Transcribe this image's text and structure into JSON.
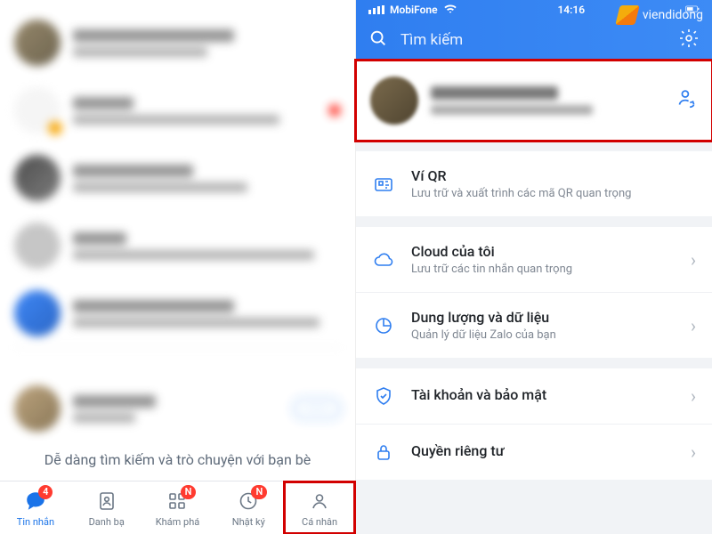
{
  "watermark": {
    "text": "viendidong"
  },
  "left": {
    "hint_text": "Dễ dàng tìm kiếm và trò chuyện với bạn bè",
    "nav": {
      "messages": {
        "label": "Tin nhắn",
        "badge": "4"
      },
      "contacts": {
        "label": "Danh bạ"
      },
      "discover": {
        "label": "Khám phá",
        "badge": "N"
      },
      "diary": {
        "label": "Nhật ký",
        "badge": "N"
      },
      "personal": {
        "label": "Cá nhân"
      }
    }
  },
  "right": {
    "status": {
      "carrier": "MobiFone",
      "time": "14:16",
      "battery_icon": "battery"
    },
    "search_placeholder": "Tìm kiếm",
    "menu": {
      "qr": {
        "title": "Ví QR",
        "subtitle": "Lưu trữ và xuất trình các mã QR quan trọng"
      },
      "cloud": {
        "title": "Cloud của tôi",
        "subtitle": "Lưu trữ các tin nhắn quan trọng"
      },
      "storage": {
        "title": "Dung lượng và dữ liệu",
        "subtitle": "Quản lý dữ liệu Zalo của bạn"
      },
      "security": {
        "title": "Tài khoản và bảo mật"
      },
      "privacy": {
        "title": "Quyền riêng tư"
      }
    }
  }
}
